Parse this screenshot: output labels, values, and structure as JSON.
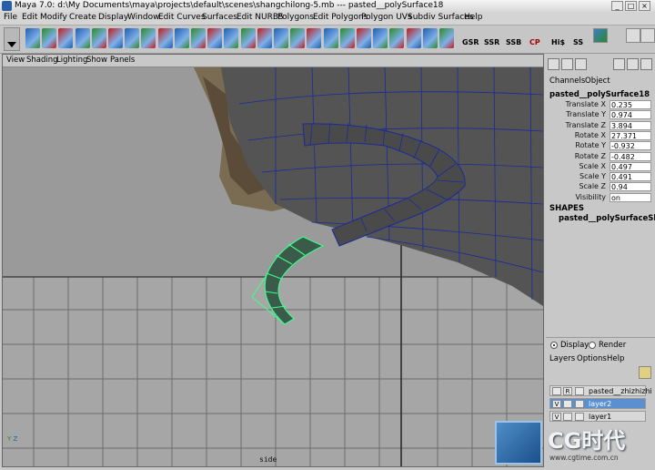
{
  "window": {
    "title": "Maya 7.0: d:\\My Documents\\maya\\projects\\default\\scenes\\shangchilong-5.mb  ---  pasted__polySurface18"
  },
  "menubar": {
    "items": [
      "File",
      "Edit",
      "Modify",
      "Create",
      "Display",
      "Window",
      "Edit Curves",
      "Surfaces",
      "Edit NURBS",
      "Polygons",
      "Edit Polygons",
      "Polygon UVs",
      "Subdiv Surfaces",
      "Help"
    ]
  },
  "shelf": {
    "text_buttons": [
      "GSR",
      "SSR",
      "SSB",
      "CP",
      "Hi$",
      "SS"
    ],
    "icons": [
      "move-tool-icon",
      "scale-tool-icon",
      "sphere-icon",
      "cube-icon",
      "cylinder-icon",
      "split-polygon-icon",
      "extrude-face-icon",
      "merge-vertices-icon",
      "smooth-icon",
      "combine-icon",
      "separate-icon",
      "bevel-icon",
      "append-polygon-icon",
      "wedge-icon",
      "duplicate-face-icon",
      "extract-icon",
      "poke-icon",
      "subdivide-icon",
      "collapse-icon",
      "delete-edge-icon",
      "chamfer-icon",
      "cut-faces-icon",
      "mirror-icon",
      "split-edge-ring-icon",
      "uv-map-icon",
      "uv-editor-icon"
    ],
    "colors": {
      "icon_blue": "#1f5fb0",
      "icon_red": "#c21b1b",
      "icon_green": "#2a8a2a"
    }
  },
  "viewport": {
    "panel_menu": [
      "View",
      "Shading",
      "Lighting",
      "Show",
      "Panels"
    ],
    "camera_label": "side",
    "axis_labels": {
      "y": "Y",
      "z": "Z"
    },
    "colors": {
      "wireframe": "#1a2a9a",
      "selection": "#3cff8c",
      "grid": "#6c6c6c",
      "ground": "#a6a6a6",
      "mesh": "#5a5a5a"
    }
  },
  "right_toolbar": {
    "icons": [
      "channel-box-icon",
      "attribute-editor-icon",
      "tool-settings-icon",
      "lights-icon",
      "render-icon",
      "toggle-icon"
    ]
  },
  "channel_box": {
    "menu": [
      "Channels",
      "Object"
    ],
    "object_name": "pasted__polySurface18",
    "attributes": [
      {
        "label": "Translate X",
        "value": "0.235"
      },
      {
        "label": "Translate Y",
        "value": "0.974"
      },
      {
        "label": "Translate Z",
        "value": "3.894"
      },
      {
        "label": "Rotate X",
        "value": "27.371"
      },
      {
        "label": "Rotate Y",
        "value": "-0.932"
      },
      {
        "label": "Rotate Z",
        "value": "-0.482"
      },
      {
        "label": "Scale X",
        "value": "0.497"
      },
      {
        "label": "Scale Y",
        "value": "0.491"
      },
      {
        "label": "Scale Z",
        "value": "0.94"
      },
      {
        "label": "Visibility",
        "value": "on"
      }
    ],
    "shapes_title": "SHAPES",
    "shape_name": "pasted__polySurfaceSha"
  },
  "layer_editor": {
    "modes": [
      {
        "label": "Display",
        "selected": true
      },
      {
        "label": "Render",
        "selected": false
      }
    ],
    "menu": [
      "Layers",
      "Options",
      "Help"
    ],
    "layers": [
      {
        "visible": "",
        "flag": "R",
        "name": "pasted__zhizhizhi",
        "selected": false
      },
      {
        "visible": "V",
        "flag": "",
        "name": "layer2",
        "selected": true
      },
      {
        "visible": "V",
        "flag": "",
        "name": "layer1",
        "selected": false
      }
    ]
  },
  "watermark": {
    "text": "CG时代",
    "url": "www.cgtime.com.cn"
  }
}
